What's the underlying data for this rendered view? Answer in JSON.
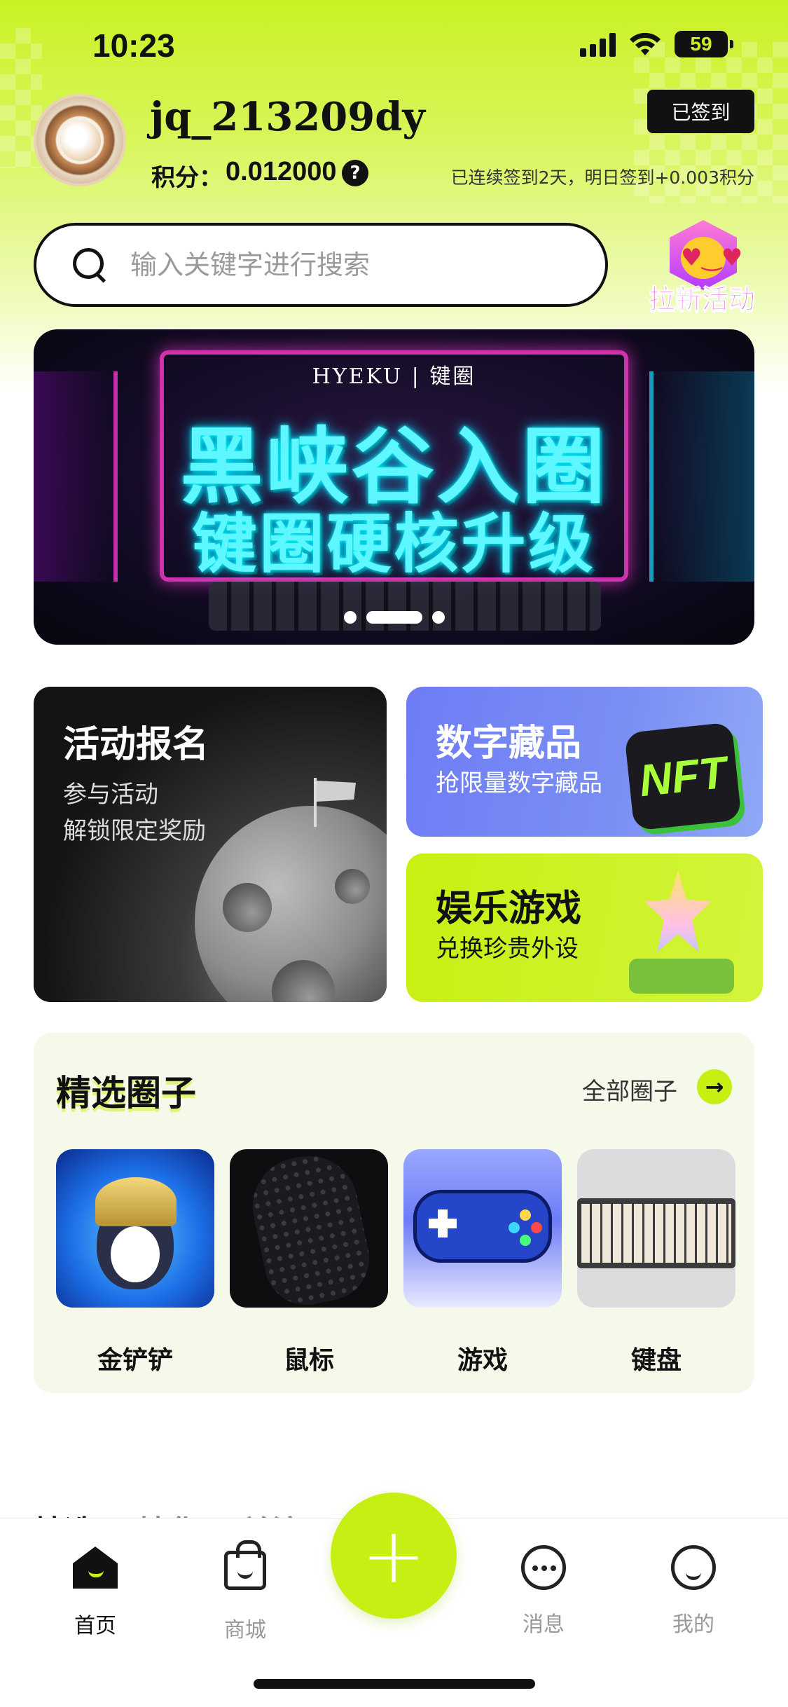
{
  "status_bar": {
    "time": "10:23",
    "battery": "59"
  },
  "profile": {
    "username": "jq_213209dy",
    "points_label": "积分：",
    "points_value": "0.012000",
    "help_symbol": "?",
    "signed_button": "已签到",
    "signin_note": "已连续签到2天，明日签到+0.003积分"
  },
  "search": {
    "placeholder": "输入关键字进行搜索"
  },
  "promo": {
    "label": "拉新活动"
  },
  "banner": {
    "brand": "HYEKU | 键圈",
    "title_line1": "黑峡谷入圈",
    "title_line2": "键圈硬核升级",
    "slides": 3,
    "active_slide": 2
  },
  "cards": {
    "activity": {
      "title": "活动报名",
      "line1": "参与活动",
      "line2": "解锁限定奖励"
    },
    "nft": {
      "title": "数字藏品",
      "subtitle": "抢限量数字藏品",
      "badge": "NFT"
    },
    "game": {
      "title": "娱乐游戏",
      "subtitle": "兑换珍贵外设"
    }
  },
  "circles": {
    "title": "精选圈子",
    "all_link": "全部圈子",
    "items": [
      {
        "label": "金铲铲"
      },
      {
        "label": "鼠标"
      },
      {
        "label": "游戏"
      },
      {
        "label": "键盘"
      }
    ]
  },
  "feed_tabs": [
    "精选",
    "精华",
    "关注"
  ],
  "bottom_nav": {
    "items": [
      {
        "label": "首页",
        "icon": "home-icon",
        "active": true
      },
      {
        "label": "商城",
        "icon": "bag-icon",
        "active": false
      },
      {
        "label": "消息",
        "icon": "chat-icon",
        "active": false
      },
      {
        "label": "我的",
        "icon": "profile-icon",
        "active": false
      }
    ],
    "fab_symbol": "+"
  },
  "colors": {
    "accent": "#c6ef14",
    "dark": "#111111",
    "nft_card": "#7a8ff4"
  }
}
